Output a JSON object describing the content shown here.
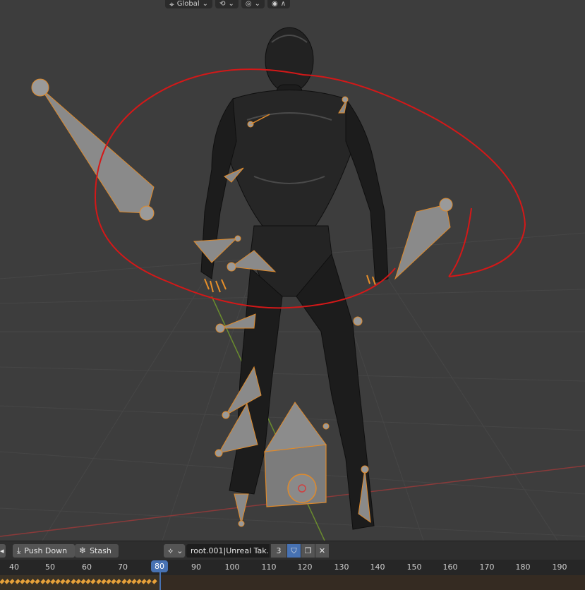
{
  "viewport_header": {
    "transform_orientation": "Global",
    "icons": [
      "orientation-icon",
      "snap-icon",
      "proportional-edit-icon",
      "overlay-icon"
    ]
  },
  "nla_bar": {
    "push_down_label": "Push Down",
    "stash_label": "Stash",
    "action_name": "root.001|Unreal Tak...",
    "user_count": "3"
  },
  "timeline": {
    "current_frame": "80",
    "ticks": [
      "40",
      "50",
      "60",
      "70",
      "90",
      "100",
      "110",
      "120",
      "130",
      "140",
      "150",
      "160",
      "170",
      "180",
      "190"
    ]
  }
}
